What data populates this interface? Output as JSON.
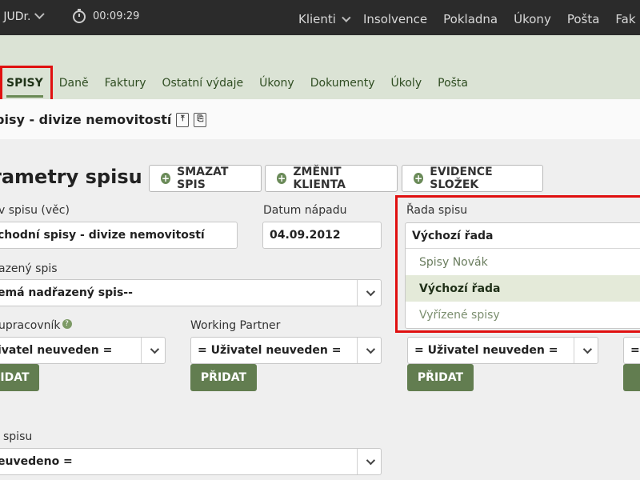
{
  "topbar": {
    "user": "l JUDr.",
    "timer": "00:09:29",
    "menu": [
      "Klienti",
      "Insolvence",
      "Pokladna",
      "Úkony",
      "Pošta",
      "Fak"
    ]
  },
  "subnav": {
    "tabs": [
      "SPISY",
      "Daně",
      "Faktury",
      "Ostatní výdaje",
      "Úkony",
      "Dokumenty",
      "Úkoly",
      "Pošta"
    ],
    "active": "SPISY"
  },
  "page": {
    "title": "pisy - divize nemovitostí",
    "section_title": "rametry spisu"
  },
  "actions": {
    "delete": "SMAZAT SPIS",
    "change_client": "ZMĚNIT KLIENTA",
    "folders": "EVIDENCE SLOŽEK"
  },
  "form": {
    "name_label": "v spisu (věc)",
    "name_value": "chodní spisy - divize nemovitostí",
    "date_label": "Datum nápadu",
    "date_value": "04.09.2012",
    "series_label": "Řada spisu",
    "parent_label": "azený spis",
    "parent_value": "emá nadřazený spis--",
    "collab_label": "upracovník",
    "collab_value": "ivatel neuveden =",
    "partner_label": "Working Partner",
    "partner_value": "= Uživatel neuveden =",
    "third_value": "= Uživatel neuveden =",
    "fourth_value": "=",
    "add_label_cut": "IDAT",
    "add_label": "PŘIDAT",
    "state_label": "spisu",
    "state_value": "euvedeno ="
  },
  "series_dropdown": {
    "current": "Výchozí řada",
    "options": [
      "Spisy Novák",
      "Výchozí řada",
      "Vyřízené spisy"
    ],
    "selected": "Výchozí řada"
  },
  "colors": {
    "accent": "#627d50",
    "highlight": "#e01010"
  }
}
